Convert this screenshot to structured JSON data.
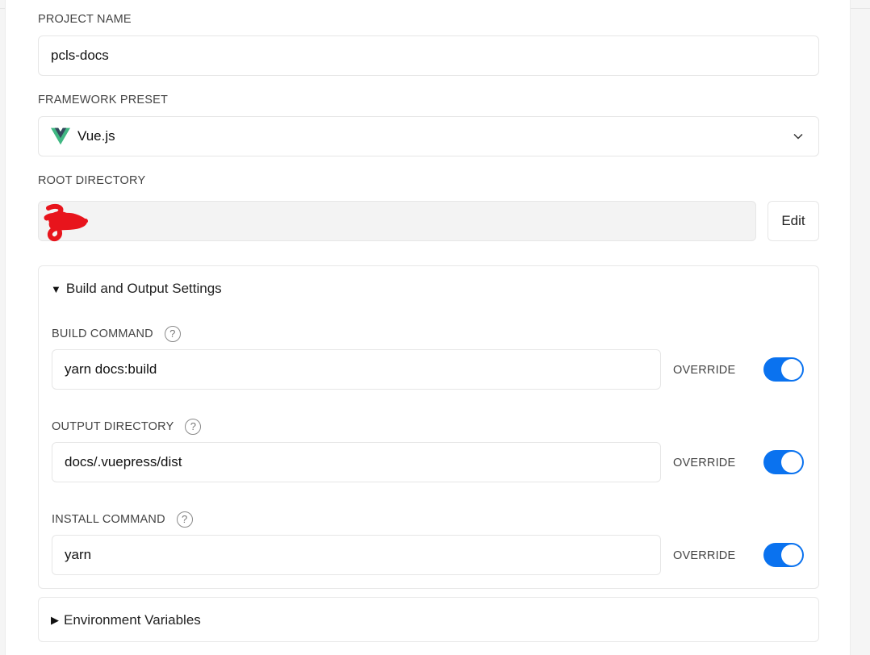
{
  "project_name": {
    "label": "PROJECT NAME",
    "value": "pcls-docs"
  },
  "framework_preset": {
    "label": "FRAMEWORK PRESET",
    "value": "Vue.js",
    "icon": "vue-logo-icon"
  },
  "root_directory": {
    "label": "ROOT DIRECTORY",
    "value": "",
    "edit_label": "Edit"
  },
  "build_settings": {
    "title": "Build and Output Settings",
    "expanded": true,
    "override_label": "OVERRIDE",
    "fields": [
      {
        "label": "BUILD COMMAND",
        "value": "yarn docs:build",
        "override": true
      },
      {
        "label": "OUTPUT DIRECTORY",
        "value": "docs/.vuepress/dist",
        "override": true
      },
      {
        "label": "INSTALL COMMAND",
        "value": "yarn",
        "override": true
      }
    ]
  },
  "environment_variables": {
    "title": "Environment Variables",
    "expanded": false
  },
  "colors": {
    "toggle_on": "#0a72ef",
    "vue_green": "#41b883",
    "vue_dark": "#35495e",
    "redaction": "#e8141c"
  },
  "help_icon": "?",
  "tri_open": "▼",
  "tri_closed": "▶"
}
